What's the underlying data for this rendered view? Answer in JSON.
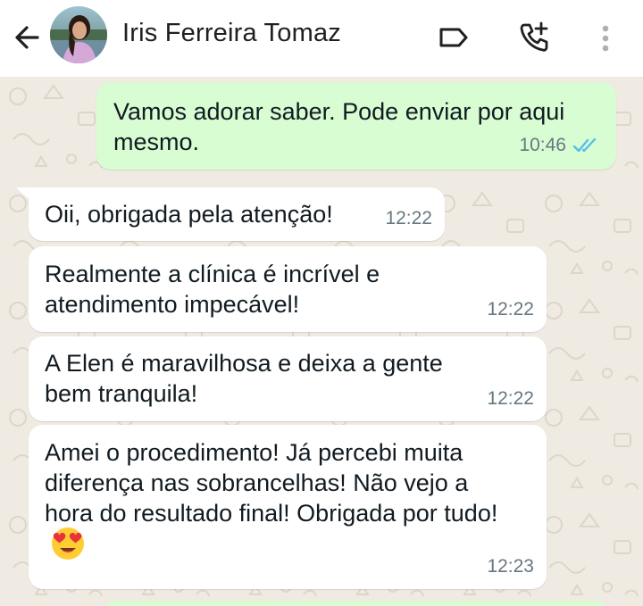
{
  "header": {
    "contact_name": "Iris Ferreira Tomaz",
    "icons": [
      "back-arrow-icon",
      "avatar",
      "label-icon",
      "add-call-icon",
      "more-vertical-icon"
    ]
  },
  "messages": [
    {
      "direction": "outgoing",
      "text": "Vamos adorar saber. Pode enviar por aqui mesmo.",
      "time": "10:46",
      "status": "read"
    },
    {
      "direction": "incoming",
      "text": "Oii, obrigada pela atenção!",
      "time": "12:22"
    },
    {
      "direction": "incoming",
      "text": "Realmente a clínica é incrível e atendimento impecável!",
      "time": "12:22"
    },
    {
      "direction": "incoming",
      "text": "A Elen é maravilhosa e deixa a gente bem tranquila!",
      "time": "12:22"
    },
    {
      "direction": "incoming",
      "text": "Amei o procedimento! Já percebi muita diferença nas sobrancelhas! Não vejo a hora do resultado final! Obrigada por tudo!",
      "time": "12:23",
      "emoji": "heart-eyes-emoji"
    }
  ],
  "colors": {
    "outgoing_bubble": "#d9fdd3",
    "incoming_bubble": "#ffffff",
    "wallpaper": "#efeae2",
    "read_ticks": "#53bdeb",
    "timestamp": "#667781"
  }
}
